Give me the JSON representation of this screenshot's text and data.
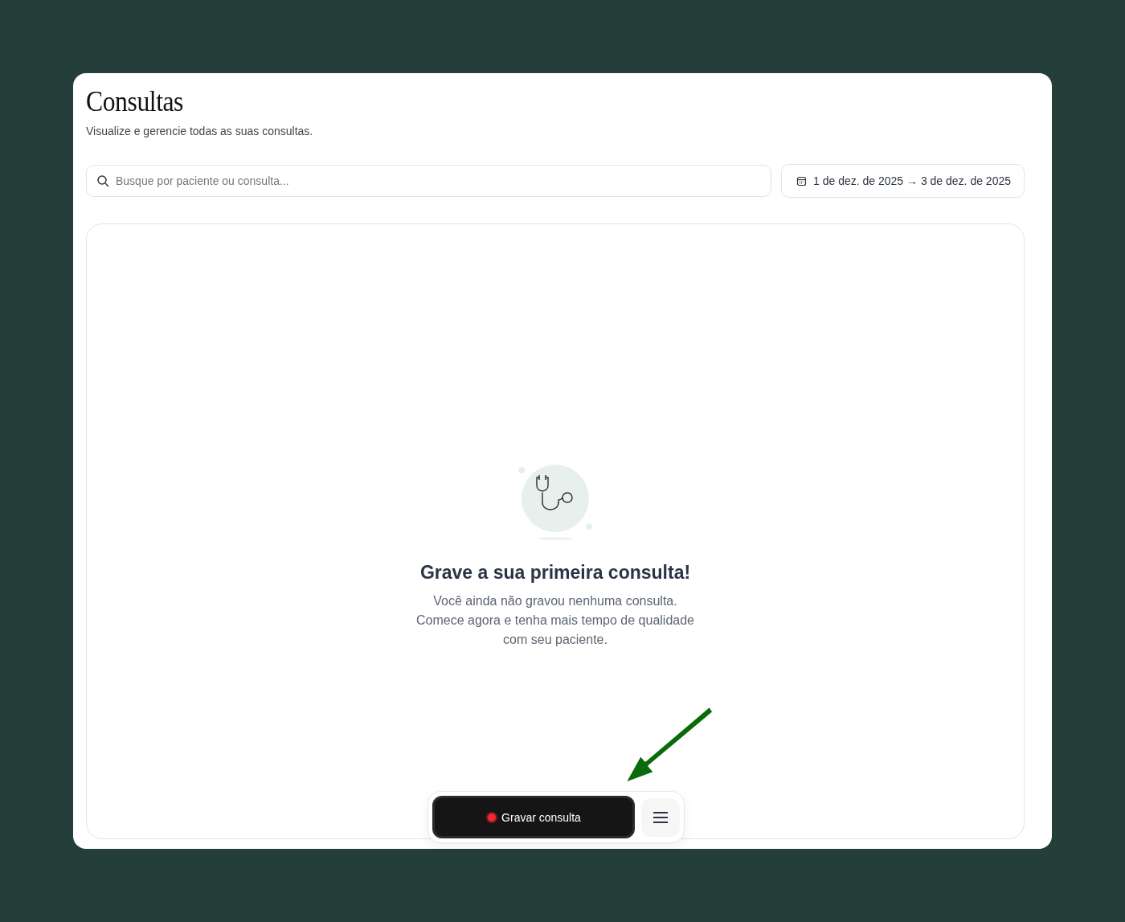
{
  "page": {
    "title": "Consultas",
    "subtitle": "Visualize e gerencie todas as suas consultas."
  },
  "search": {
    "placeholder": "Busque por paciente ou consulta..."
  },
  "date_range": {
    "label": "1 de dez. de 2025 → 3 de dez. de 2025"
  },
  "empty_state": {
    "title": "Grave a sua primeira consulta!",
    "message": "Você ainda não gravou nenhuma consulta. Comece agora e tenha mais tempo de qualidade com seu paciente."
  },
  "record_bar": {
    "record_button": "Gravar consulta"
  }
}
